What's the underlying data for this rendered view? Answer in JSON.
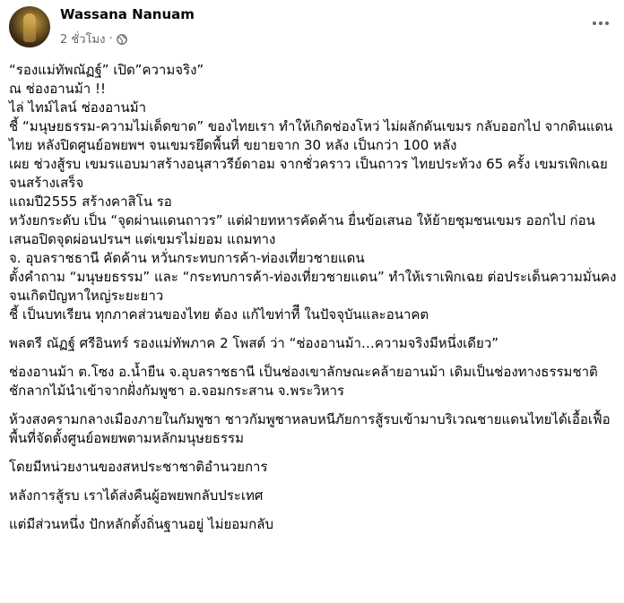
{
  "post": {
    "author": "Wassana Nanuam",
    "time": "2 ชั่วโมง",
    "separator": "·",
    "privacy_icon": "globe-icon",
    "more_icon": "more-horizontal-icon",
    "paragraphs": [
      "“รองแม่ทัพณัฏฐ์” เปิด”ความจริง”\nณ ช่องอานม้า !!\nไล่ ไทม์ไลน์ ช่องอานม้า\nชี้ “มนุษยธรรม-ความไม่เด็ดขาด” ของไทยเรา ทำให้เกิดช่องโหว่  ไม่ผลักดันเขมร กลับออกไป จากดินแดนไทย หลังปิดศูนย์อพยพฯ จนเขมรยึดพื้นที่ ขยายจาก 30 หลัง เป็นกว่า 100 หลัง\nเผย ช่วงสู้รบ เขมรแอบมาสร้างอนุสาวรีย์ดาอม  จากชั่วคราว เป็นถาวร  ไทยประท้วง 65 ครั้ง เขมรเพิกเฉย จนสร้างเสร็จ\nแถมปี2555 สร้างคาสิโน รอ\nหวังยกระดับ เป็น “จุดผ่านแดนถาวร” แต่ฝ่ายทหารคัดค้าน ยื่นข้อเสนอ ให้ย้ายชุมชนเขมร ออกไป ก่อน  เสนอปิดจุดผ่อนปรนฯ แต่เขมรไม่ยอม  แถมทาง\nจ. อุบลราชธานี คัดค้าน  หวั่นกระทบการค้า-ท่องเที่ยวชายแดน\nตั้งคำถาม “มนุษยธรรม” และ “กระทบการค้า-ท่องเที่ยวชายแดน” ทำให้เราเพิกเฉย ต่อประเด็นความมั่นคง\nจนเกิดปัญหาใหญ่ระยะยาว\nชี้ เป็นบทเรียน ทุกภาคส่วนของไทย ต้อง แก้ไขท่าทีี ในปัจจุบันและอนาคต",
      "พลตรี ณัฏฐ์  ศรีอินทร์   รองแม่ทัพภาค 2  โพสต์ ว่า  “ช่องอานม้า…ความจริงมีหนึ่งเดียว”",
      "ช่องอานม้า ต.โซง อ.น้ำยืน จ.อุบลราชธานี เป็นช่องเขาลักษณะคล้ายอานม้า เดิมเป็นช่องทางธรรมชาติ ชักลากไม้นำเข้าจากฝั่งกัมพูชา อ.จอมกระสาน จ.พระวิหาร",
      "ห้วงสงครามกลางเมืองภายในกัมพูชา ชาวกัมพูชาหลบหนีภัยการสู้รบเข้ามาบริเวณชายแดนไทยได้เอื้อเฟื้อพื้นที่จัดตั้งศูนย์อพยพตามหลักมนุษยธรรม",
      "โดยมีหน่วยงานของสหประชาชาติอำนวยการ",
      "หลังการสู้รบ  เราได้ส่งคืนผู้อพยพกลับประเทศ",
      "แต่มีส่วนหนึ่ง ปักหลักตั้งถิ่นฐานอยู่  ไม่ยอมกลับ"
    ]
  }
}
